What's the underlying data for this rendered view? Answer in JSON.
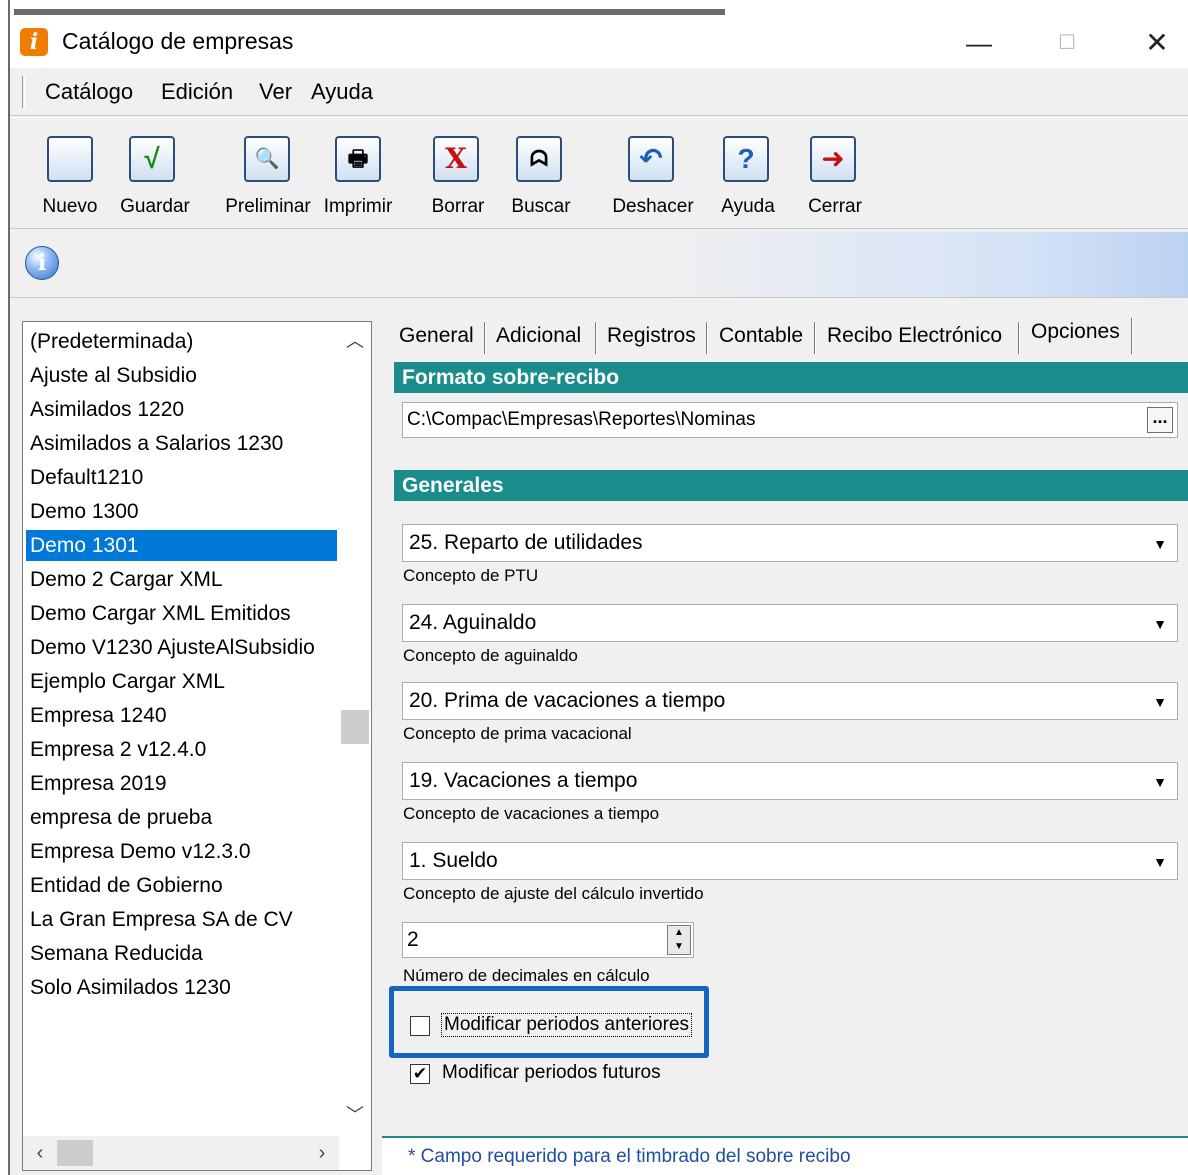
{
  "window": {
    "title": "Catálogo de empresas",
    "minimize": "—",
    "maximize": "☐",
    "close": "✕"
  },
  "menu": [
    "Catálogo",
    "Edición",
    "Ver",
    "Ayuda"
  ],
  "toolbar": [
    {
      "label": "Nuevo",
      "icon": "new-document-icon",
      "glyph": ""
    },
    {
      "label": "Guardar",
      "icon": "checkmark-icon",
      "glyph": "√"
    },
    {
      "label": "Preliminar",
      "icon": "print-preview-icon",
      "glyph": "🔍"
    },
    {
      "label": "Imprimir",
      "icon": "printer-icon",
      "glyph": "🖶"
    },
    {
      "label": "Borrar",
      "icon": "delete-x-icon",
      "glyph": "X"
    },
    {
      "label": "Buscar",
      "icon": "binoculars-icon",
      "glyph": "ᗣ"
    },
    {
      "label": "Deshacer",
      "icon": "undo-icon",
      "glyph": "↶"
    },
    {
      "label": "Ayuda",
      "icon": "help-icon",
      "glyph": "?"
    },
    {
      "label": "Cerrar",
      "icon": "exit-door-icon",
      "glyph": "➜"
    }
  ],
  "companies": {
    "items": [
      "(Predeterminada)",
      "Ajuste al Subsidio",
      "Asimilados 1220",
      "Asimilados a Salarios 1230",
      "Default1210",
      "Demo 1300",
      "Demo 1301",
      "Demo 2 Cargar XML",
      "Demo Cargar XML Emitidos",
      "Demo V1230 AjusteAlSubsidio",
      "Ejemplo Cargar XML",
      "Empresa 1240",
      "Empresa 2 v12.4.0",
      "Empresa 2019",
      "empresa de prueba",
      "Empresa Demo v12.3.0",
      "Entidad de Gobierno",
      "La Gran Empresa SA de CV",
      "Semana Reducida",
      "Solo Asimilados 1230"
    ],
    "selected_index": 6
  },
  "tabs": {
    "items": [
      "General",
      "Adicional",
      "Registros",
      "Contable",
      "Recibo Electrónico",
      "Opciones"
    ],
    "active": "Opciones"
  },
  "formato": {
    "header": "Formato sobre-recibo",
    "path": "C:\\Compac\\Empresas\\Reportes\\Nominas",
    "browse": "..."
  },
  "generales": {
    "header": "Generales",
    "fields": [
      {
        "value": "25. Reparto de utilidades",
        "caption": "Concepto de PTU"
      },
      {
        "value": "24. Aguinaldo",
        "caption": "Concepto de aguinaldo"
      },
      {
        "value": "20. Prima de vacaciones a tiempo",
        "caption": "Concepto de prima vacacional"
      },
      {
        "value": "19. Vacaciones a tiempo",
        "caption": "Concepto de vacaciones a tiempo"
      },
      {
        "value": "1. Sueldo",
        "caption": "Concepto de ajuste del cálculo invertido"
      }
    ],
    "decimales": {
      "value": "2",
      "caption": "Número de decimales en cálculo"
    },
    "checks": [
      {
        "label": "Modificar periodos anteriores",
        "checked": false
      },
      {
        "label": "Modificar periodos futuros",
        "checked": true
      }
    ]
  },
  "footer_note": "* Campo requerido para el timbrado del sobre recibo",
  "colors": {
    "section_header": "#1a8c8c",
    "selection": "#0078d7",
    "highlight_box": "#1565c0",
    "footer_text": "#1f4f9c"
  }
}
